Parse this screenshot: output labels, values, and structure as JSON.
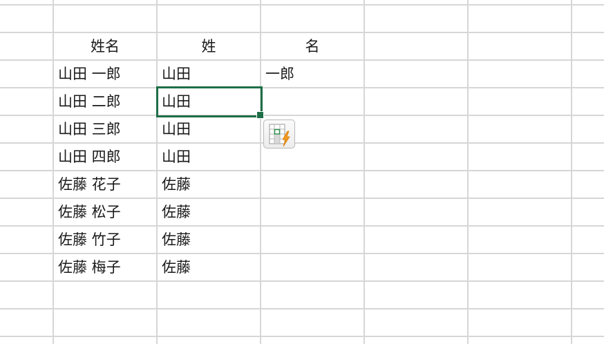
{
  "sheet": {
    "header_row": {
      "col_b": "姓名",
      "col_c": "姓",
      "col_d": "名"
    },
    "rows": [
      {
        "full_name": "山田 一郎",
        "surname": "山田",
        "given": "一郎"
      },
      {
        "full_name": "山田 二郎",
        "surname": "山田",
        "given": ""
      },
      {
        "full_name": "山田 三郎",
        "surname": "山田",
        "given": ""
      },
      {
        "full_name": "山田 四郎",
        "surname": "山田",
        "given": ""
      },
      {
        "full_name": "佐藤 花子",
        "surname": "佐藤",
        "given": ""
      },
      {
        "full_name": "佐藤 松子",
        "surname": "佐藤",
        "given": ""
      },
      {
        "full_name": "佐藤 竹子",
        "surname": "佐藤",
        "given": ""
      },
      {
        "full_name": "佐藤 梅子",
        "surname": "佐藤",
        "given": ""
      }
    ]
  },
  "colors": {
    "gridline": "#d6d6d6",
    "selection": "#1e6e47",
    "flash_fill_bolt": "#f29a1f"
  },
  "icons": {
    "flash_fill": "flash-fill-icon"
  }
}
